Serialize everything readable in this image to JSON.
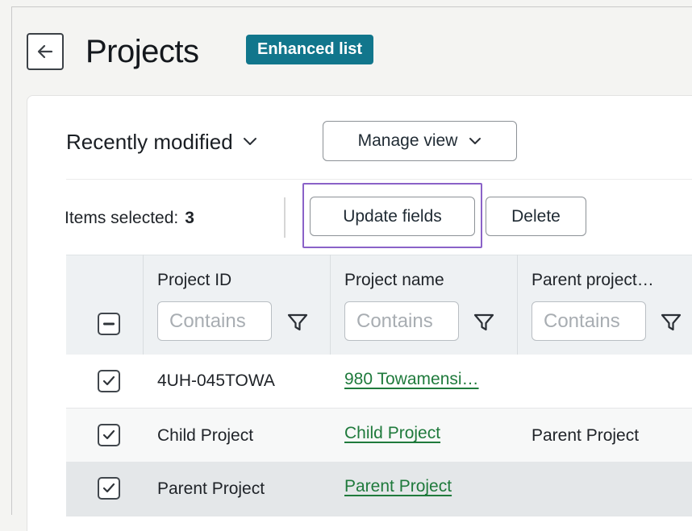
{
  "header": {
    "title": "Projects",
    "badge": "Enhanced list",
    "back_icon": "arrow-left-icon"
  },
  "toolbar": {
    "view_label": "Recently modified",
    "manage_view_label": "Manage view",
    "items_selected_label": "Items selected:",
    "items_selected_count": "3",
    "update_fields_label": "Update fields",
    "delete_label": "Delete"
  },
  "table": {
    "columns": [
      {
        "label": "Project ID",
        "filter_placeholder": "Contains"
      },
      {
        "label": "Project name",
        "filter_placeholder": "Contains"
      },
      {
        "label": "Parent project…",
        "filter_placeholder": "Contains"
      }
    ],
    "header_checkbox_state": "indeterminate",
    "rows": [
      {
        "checked": true,
        "project_id": "4UH-045TOWA",
        "project_name": "980 Towamensi…",
        "parent_project": ""
      },
      {
        "checked": true,
        "project_id": "Child Project",
        "project_name": "Child Project",
        "parent_project": "Parent Project"
      },
      {
        "checked": true,
        "project_id": "Parent Project",
        "project_name": "Parent Project",
        "parent_project": ""
      }
    ]
  },
  "colors": {
    "badge_bg": "#11768c",
    "link": "#1f7a3c",
    "focus_ring": "#8a62c8",
    "header_bg": "#eef1f3",
    "row_alt_bg": "#f7f8f8",
    "row_selected_bg": "#e4e7e9"
  }
}
